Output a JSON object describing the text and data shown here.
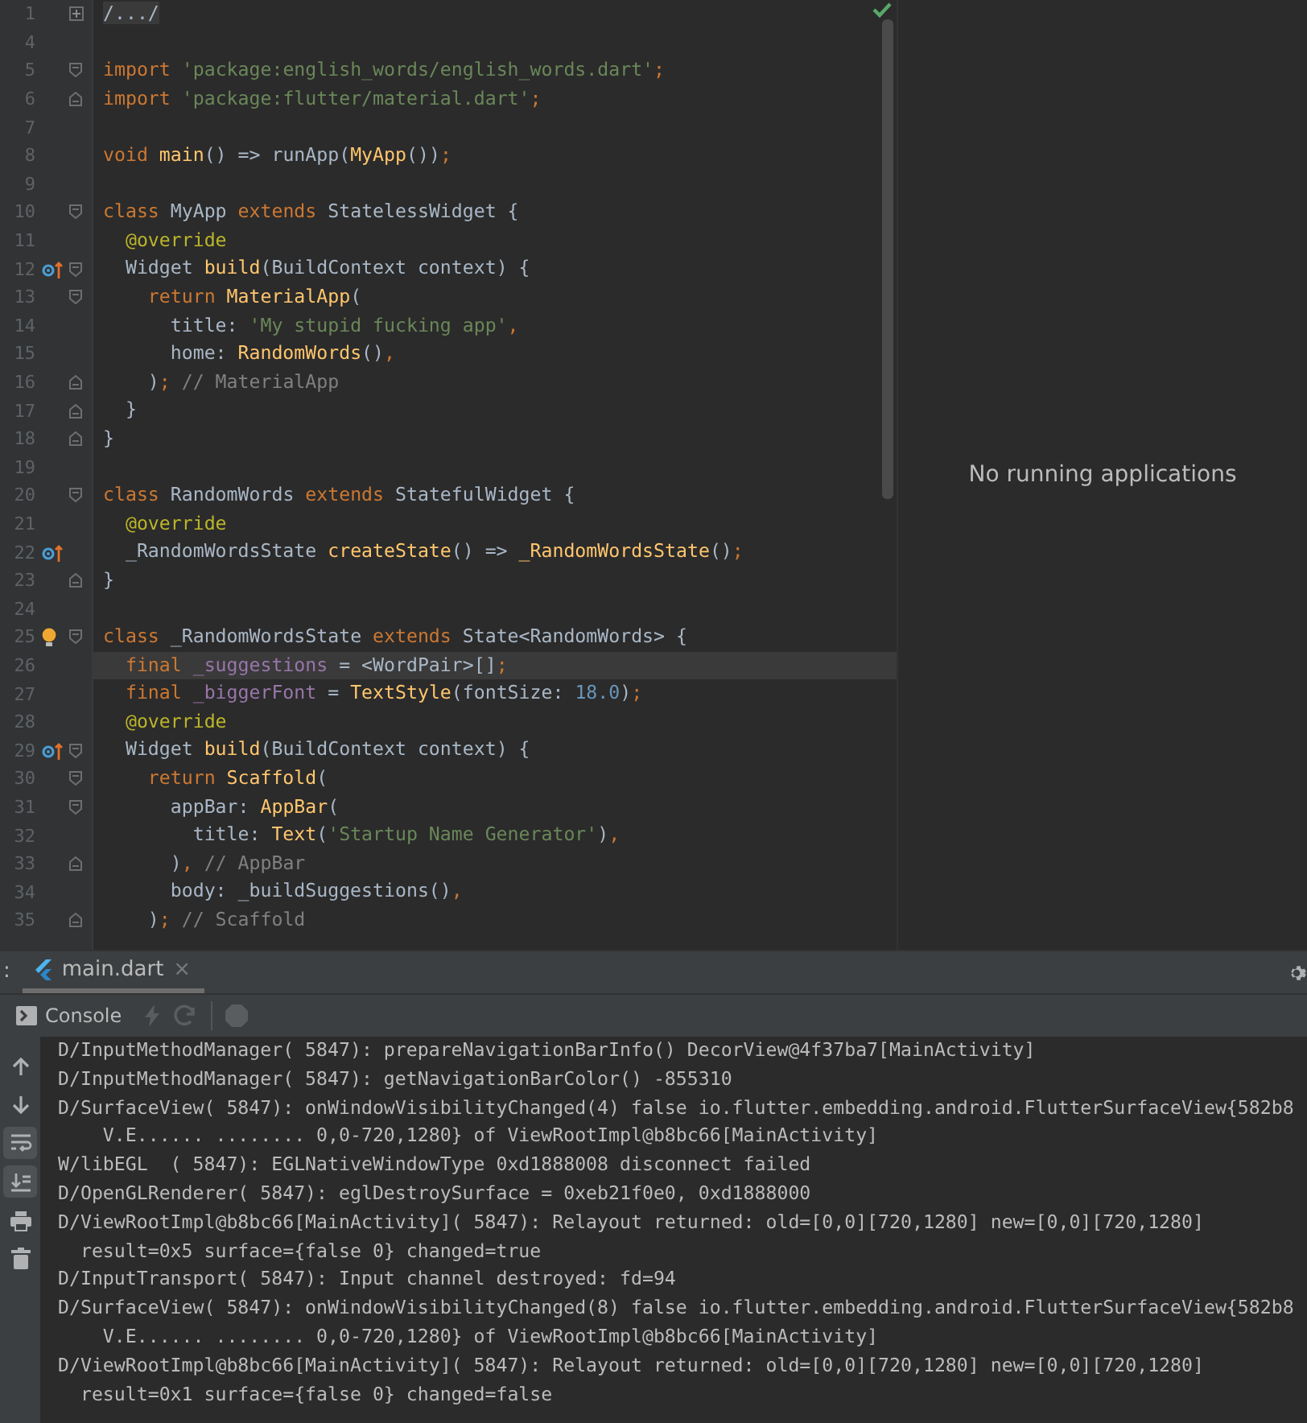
{
  "editor": {
    "lines": [
      {
        "n": "1",
        "collapsed": true,
        "fold_start": false,
        "fold_end": false,
        "override": false,
        "bulb": false,
        "current": false,
        "tokens": [
          {
            "kind": "folded",
            "text": "/.../"
          }
        ]
      },
      {
        "n": "4",
        "collapsed": false,
        "fold_start": false,
        "fold_end": false,
        "override": false,
        "bulb": false,
        "current": false
      },
      {
        "n": "5",
        "collapsed": false,
        "fold_start": true,
        "fold_end": false,
        "override": false,
        "bulb": false,
        "current": false,
        "tokens": [
          {
            "kind": "keyword",
            "text": "import "
          },
          {
            "kind": "string",
            "text": "'package:english_words/english_words.dart'"
          },
          {
            "kind": "keyword",
            "text": ";"
          }
        ]
      },
      {
        "n": "6",
        "collapsed": false,
        "fold_start": false,
        "fold_end": true,
        "override": false,
        "bulb": false,
        "current": false,
        "tokens": [
          {
            "kind": "keyword",
            "text": "import "
          },
          {
            "kind": "string",
            "text": "'package:flutter/material.dart'"
          },
          {
            "kind": "keyword",
            "text": ";"
          }
        ]
      },
      {
        "n": "7",
        "collapsed": false,
        "fold_start": false,
        "fold_end": false,
        "override": false,
        "bulb": false,
        "current": false
      },
      {
        "n": "8",
        "collapsed": false,
        "fold_start": false,
        "fold_end": false,
        "override": false,
        "bulb": false,
        "current": false,
        "tokens": [
          {
            "kind": "keyword",
            "text": "void "
          },
          {
            "kind": "function",
            "text": "main"
          },
          {
            "kind": "plain",
            "text": "() => runApp("
          },
          {
            "kind": "function",
            "text": "MyApp"
          },
          {
            "kind": "plain",
            "text": "())"
          },
          {
            "kind": "keyword",
            "text": ";"
          }
        ]
      },
      {
        "n": "9",
        "collapsed": false,
        "fold_start": false,
        "fold_end": false,
        "override": false,
        "bulb": false,
        "current": false
      },
      {
        "n": "10",
        "collapsed": false,
        "fold_start": true,
        "fold_end": false,
        "override": false,
        "bulb": false,
        "current": false,
        "tokens": [
          {
            "kind": "keyword",
            "text": "class "
          },
          {
            "kind": "plain",
            "text": "MyApp "
          },
          {
            "kind": "keyword",
            "text": "extends "
          },
          {
            "kind": "plain",
            "text": "StatelessWidget {"
          }
        ]
      },
      {
        "n": "11",
        "collapsed": false,
        "fold_start": false,
        "fold_end": false,
        "override": false,
        "bulb": false,
        "current": false,
        "tokens": [
          {
            "kind": "annotation",
            "text": "  @override"
          }
        ]
      },
      {
        "n": "12",
        "collapsed": false,
        "fold_start": true,
        "fold_end": false,
        "override": true,
        "bulb": false,
        "current": false,
        "tokens": [
          {
            "kind": "plain",
            "text": "  Widget "
          },
          {
            "kind": "function",
            "text": "build"
          },
          {
            "kind": "plain",
            "text": "(BuildContext context) {"
          }
        ]
      },
      {
        "n": "13",
        "collapsed": false,
        "fold_start": true,
        "fold_end": false,
        "override": false,
        "bulb": false,
        "current": false,
        "tokens": [
          {
            "kind": "keyword",
            "text": "    return "
          },
          {
            "kind": "function",
            "text": "MaterialApp"
          },
          {
            "kind": "plain",
            "text": "("
          }
        ]
      },
      {
        "n": "14",
        "collapsed": false,
        "fold_start": false,
        "fold_end": false,
        "override": false,
        "bulb": false,
        "current": false,
        "tokens": [
          {
            "kind": "plain",
            "text": "      title: "
          },
          {
            "kind": "string",
            "text": "'My stupid fucking app'"
          },
          {
            "kind": "keyword",
            "text": ","
          }
        ]
      },
      {
        "n": "15",
        "collapsed": false,
        "fold_start": false,
        "fold_end": false,
        "override": false,
        "bulb": false,
        "current": false,
        "tokens": [
          {
            "kind": "plain",
            "text": "      home: "
          },
          {
            "kind": "function",
            "text": "RandomWords"
          },
          {
            "kind": "plain",
            "text": "()"
          },
          {
            "kind": "keyword",
            "text": ","
          }
        ]
      },
      {
        "n": "16",
        "collapsed": false,
        "fold_start": false,
        "fold_end": true,
        "override": false,
        "bulb": false,
        "current": false,
        "tokens": [
          {
            "kind": "plain",
            "text": "    )"
          },
          {
            "kind": "keyword",
            "text": ";"
          },
          {
            "kind": "comment",
            "text": " // MaterialApp"
          }
        ]
      },
      {
        "n": "17",
        "collapsed": false,
        "fold_start": false,
        "fold_end": true,
        "override": false,
        "bulb": false,
        "current": false,
        "tokens": [
          {
            "kind": "plain",
            "text": "  }"
          }
        ]
      },
      {
        "n": "18",
        "collapsed": false,
        "fold_start": false,
        "fold_end": true,
        "override": false,
        "bulb": false,
        "current": false,
        "tokens": [
          {
            "kind": "plain",
            "text": "}"
          }
        ]
      },
      {
        "n": "19",
        "collapsed": false,
        "fold_start": false,
        "fold_end": false,
        "override": false,
        "bulb": false,
        "current": false
      },
      {
        "n": "20",
        "collapsed": false,
        "fold_start": true,
        "fold_end": false,
        "override": false,
        "bulb": false,
        "current": false,
        "tokens": [
          {
            "kind": "keyword",
            "text": "class "
          },
          {
            "kind": "plain",
            "text": "RandomWords "
          },
          {
            "kind": "keyword",
            "text": "extends "
          },
          {
            "kind": "plain",
            "text": "StatefulWidget {"
          }
        ]
      },
      {
        "n": "21",
        "collapsed": false,
        "fold_start": false,
        "fold_end": false,
        "override": false,
        "bulb": false,
        "current": false,
        "tokens": [
          {
            "kind": "annotation",
            "text": "  @override"
          }
        ]
      },
      {
        "n": "22",
        "collapsed": false,
        "fold_start": false,
        "fold_end": false,
        "override": true,
        "bulb": false,
        "current": false,
        "tokens": [
          {
            "kind": "plain",
            "text": "  _RandomWordsState "
          },
          {
            "kind": "function",
            "text": "createState"
          },
          {
            "kind": "plain",
            "text": "() => "
          },
          {
            "kind": "function",
            "text": "_RandomWordsState"
          },
          {
            "kind": "plain",
            "text": "()"
          },
          {
            "kind": "keyword",
            "text": ";"
          }
        ]
      },
      {
        "n": "23",
        "collapsed": false,
        "fold_start": false,
        "fold_end": true,
        "override": false,
        "bulb": false,
        "current": false,
        "tokens": [
          {
            "kind": "plain",
            "text": "}"
          }
        ]
      },
      {
        "n": "24",
        "collapsed": false,
        "fold_start": false,
        "fold_end": false,
        "override": false,
        "bulb": false,
        "current": false
      },
      {
        "n": "25",
        "collapsed": false,
        "fold_start": true,
        "fold_end": false,
        "override": false,
        "bulb": true,
        "current": false,
        "tokens": [
          {
            "kind": "keyword",
            "text": "class "
          },
          {
            "kind": "plain",
            "text": "_RandomWordsState "
          },
          {
            "kind": "keyword",
            "text": "extends "
          },
          {
            "kind": "plain",
            "text": "State<RandomWords> {"
          }
        ]
      },
      {
        "n": "26",
        "collapsed": false,
        "fold_start": false,
        "fold_end": false,
        "override": false,
        "bulb": false,
        "current": true,
        "tokens": [
          {
            "kind": "keyword",
            "text": "  final "
          },
          {
            "kind": "field",
            "text": "_suggestions"
          },
          {
            "kind": "plain",
            "text": " = <WordPair>[]"
          },
          {
            "kind": "keyword",
            "text": ";"
          }
        ]
      },
      {
        "n": "27",
        "collapsed": false,
        "fold_start": false,
        "fold_end": false,
        "override": false,
        "bulb": false,
        "current": false,
        "tokens": [
          {
            "kind": "keyword",
            "text": "  final "
          },
          {
            "kind": "field",
            "text": "_biggerFont"
          },
          {
            "kind": "plain",
            "text": " = "
          },
          {
            "kind": "function",
            "text": "TextStyle"
          },
          {
            "kind": "plain",
            "text": "(fontSize: "
          },
          {
            "kind": "number",
            "text": "18.0"
          },
          {
            "kind": "plain",
            "text": ")"
          },
          {
            "kind": "keyword",
            "text": ";"
          }
        ]
      },
      {
        "n": "28",
        "collapsed": false,
        "fold_start": false,
        "fold_end": false,
        "override": false,
        "bulb": false,
        "current": false,
        "tokens": [
          {
            "kind": "annotation",
            "text": "  @override"
          }
        ]
      },
      {
        "n": "29",
        "collapsed": false,
        "fold_start": true,
        "fold_end": false,
        "override": true,
        "bulb": false,
        "current": false,
        "tokens": [
          {
            "kind": "plain",
            "text": "  Widget "
          },
          {
            "kind": "function",
            "text": "build"
          },
          {
            "kind": "plain",
            "text": "(BuildContext context) {"
          }
        ]
      },
      {
        "n": "30",
        "collapsed": false,
        "fold_start": true,
        "fold_end": false,
        "override": false,
        "bulb": false,
        "current": false,
        "tokens": [
          {
            "kind": "keyword",
            "text": "    return "
          },
          {
            "kind": "function",
            "text": "Scaffold"
          },
          {
            "kind": "plain",
            "text": "("
          }
        ]
      },
      {
        "n": "31",
        "collapsed": false,
        "fold_start": true,
        "fold_end": false,
        "override": false,
        "bulb": false,
        "current": false,
        "tokens": [
          {
            "kind": "plain",
            "text": "      appBar: "
          },
          {
            "kind": "function",
            "text": "AppBar"
          },
          {
            "kind": "plain",
            "text": "("
          }
        ]
      },
      {
        "n": "32",
        "collapsed": false,
        "fold_start": false,
        "fold_end": false,
        "override": false,
        "bulb": false,
        "current": false,
        "tokens": [
          {
            "kind": "plain",
            "text": "        title: "
          },
          {
            "kind": "function",
            "text": "Text"
          },
          {
            "kind": "plain",
            "text": "("
          },
          {
            "kind": "string",
            "text": "'Startup Name Generator'"
          },
          {
            "kind": "plain",
            "text": ")"
          },
          {
            "kind": "keyword",
            "text": ","
          }
        ]
      },
      {
        "n": "33",
        "collapsed": false,
        "fold_start": false,
        "fold_end": true,
        "override": false,
        "bulb": false,
        "current": false,
        "tokens": [
          {
            "kind": "plain",
            "text": "      )"
          },
          {
            "kind": "keyword",
            "text": ","
          },
          {
            "kind": "comment",
            "text": " // AppBar"
          }
        ]
      },
      {
        "n": "34",
        "collapsed": false,
        "fold_start": false,
        "fold_end": false,
        "override": false,
        "bulb": false,
        "current": false,
        "tokens": [
          {
            "kind": "plain",
            "text": "      body: _buildSuggestions()"
          },
          {
            "kind": "keyword",
            "text": ","
          }
        ]
      },
      {
        "n": "35",
        "collapsed": false,
        "fold_start": false,
        "fold_end": true,
        "override": false,
        "bulb": false,
        "current": false,
        "tokens": [
          {
            "kind": "plain",
            "text": "    )"
          },
          {
            "kind": "keyword",
            "text": ";"
          },
          {
            "kind": "comment",
            "text": " // Scaffold"
          }
        ]
      }
    ]
  },
  "devices_panel": {
    "message": "No running applications"
  },
  "run_panel": {
    "prefix": ":",
    "tab": {
      "label": "main.dart",
      "close": "×",
      "selected": true
    },
    "toolbar": {
      "console_tab": "Console"
    },
    "side_tools": [
      {
        "kind": "up",
        "on": false
      },
      {
        "kind": "down",
        "on": false
      },
      {
        "kind": "wrap",
        "on": true
      },
      {
        "kind": "scroll-end",
        "on": true
      },
      {
        "kind": "print",
        "on": false
      },
      {
        "kind": "trash",
        "on": false
      }
    ],
    "console": [
      "D/InputMethodManager( 5847): prepareNavigationBarInfo() DecorView@4f37ba7[MainActivity]",
      "D/InputMethodManager( 5847): getNavigationBarColor() -855310",
      "D/SurfaceView( 5847): onWindowVisibilityChanged(4) false io.flutter.embedding.android.FlutterSurfaceView{582b8",
      "    V.E...... ........ 0,0-720,1280} of ViewRootImpl@b8bc66[MainActivity]",
      "W/libEGL  ( 5847): EGLNativeWindowType 0xd1888008 disconnect failed",
      "D/OpenGLRenderer( 5847): eglDestroySurface = 0xeb21f0e0, 0xd1888000",
      "D/ViewRootImpl@b8bc66[MainActivity]( 5847): Relayout returned: old=[0,0][720,1280] new=[0,0][720,1280]",
      "  result=0x5 surface={false 0} changed=true",
      "D/InputTransport( 5847): Input channel destroyed: fd=94",
      "D/SurfaceView( 5847): onWindowVisibilityChanged(8) false io.flutter.embedding.android.FlutterSurfaceView{582b8",
      "    V.E...... ........ 0,0-720,1280} of ViewRootImpl@b8bc66[MainActivity]",
      "D/ViewRootImpl@b8bc66[MainActivity]( 5847): Relayout returned: old=[0,0][720,1280] new=[0,0][720,1280]",
      "  result=0x1 surface={false 0} changed=false"
    ]
  }
}
